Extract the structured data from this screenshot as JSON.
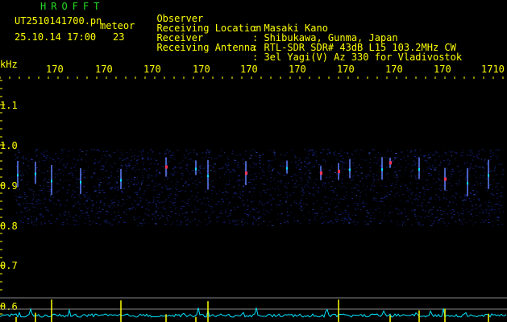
{
  "header": {
    "program": "HROFFT",
    "filename": "UT2510141700.pn",
    "filename_suffix": "meteor",
    "datetime": "25.10.14 17:00",
    "count": "23",
    "observer_label": "Observer",
    "observer_value": ": Masaki Kano",
    "location_label": "Receiving Location",
    "location_value": ": Shibukawa, Gunma, Japan",
    "receiver_label": "Receiver",
    "receiver_value": ": RTL-SDR SDR# 43dB L15 103.2MHz CW",
    "antenna_label": "Receiving Antenna",
    "antenna_value": ": 3el Yagi(V) Az 330 for Vladivostok"
  },
  "axis": {
    "unit": "kHz",
    "x_ticks": [
      "170",
      "170",
      "170",
      "170",
      "170",
      "170",
      "170",
      "170",
      "170",
      "1710"
    ],
    "y_ticks": [
      "1.1",
      "1.0",
      "0.9",
      "0.8",
      "0.7",
      "0.6"
    ]
  },
  "colors": {
    "text": "#ffff00",
    "title": "#22dd22",
    "background": "#000000",
    "noise": "#1a2a9a",
    "signal": "#ff3355",
    "level": "#00e5ff"
  }
}
